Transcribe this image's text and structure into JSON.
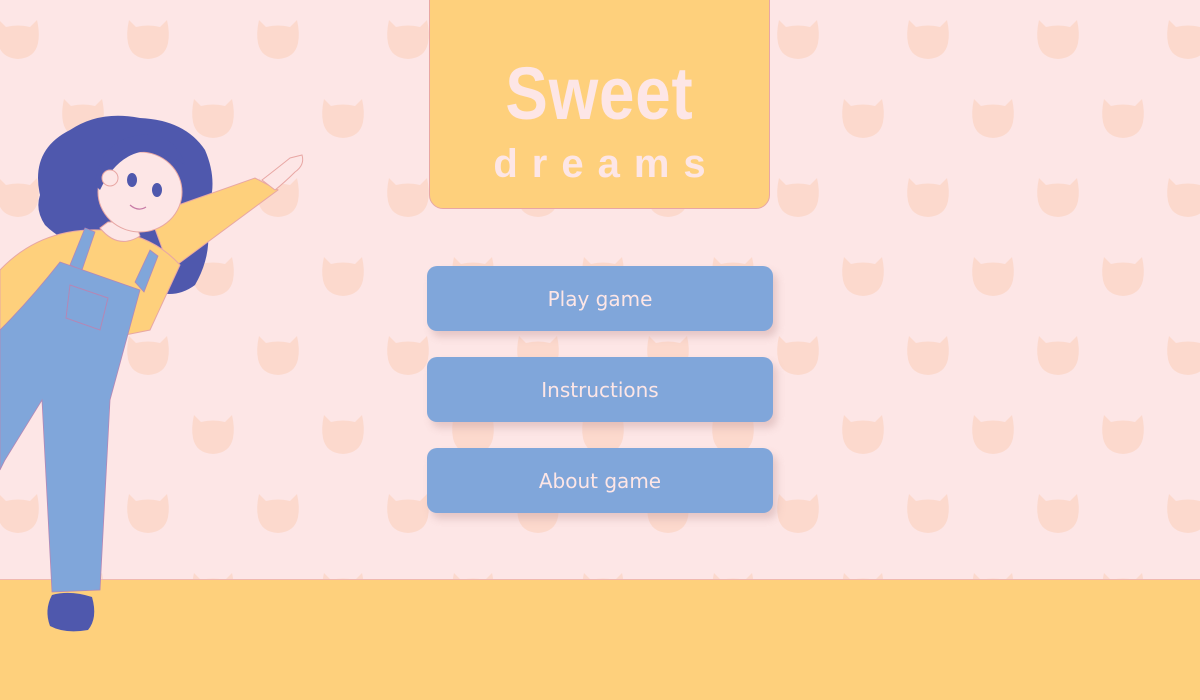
{
  "title": {
    "main": "Sweet",
    "sub": "dreams"
  },
  "menu": {
    "play_label": "Play game",
    "instructions_label": "Instructions",
    "about_label": "About game"
  },
  "colors": {
    "background": "#fde6e6",
    "floor": "#fed07c",
    "button": "#80a6da",
    "title_text": "#fde6e6",
    "pattern": "#fcd7c9",
    "hair": "#4f58ad"
  },
  "icons": {
    "pattern_shape": "cat-head-icon"
  }
}
